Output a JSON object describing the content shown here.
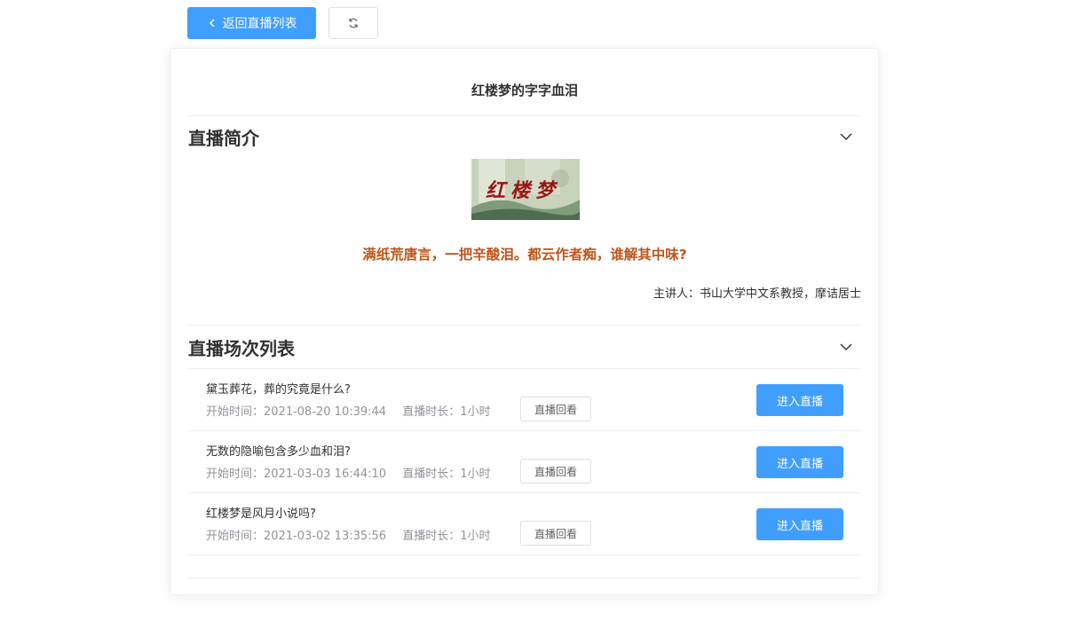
{
  "toolbar": {
    "back_label": "返回直播列表",
    "back_icon": "chevron-left-icon",
    "refresh_icon": "refresh-icon"
  },
  "course": {
    "title": "红楼梦的字字血泪",
    "intro_heading": "直播简介",
    "cover_text": "红楼梦",
    "motto": "满纸荒唐言，一把辛酸泪。都云作者痴，谁解其中味?",
    "speaker": "主讲人：书山大学中文系教授，摩诘居士"
  },
  "sessions_section": {
    "heading": "直播场次列表",
    "items": [
      {
        "title": "黛玉葬花，葬的究竟是什么?",
        "start": "开始时间：2021-08-20 10:39:44",
        "duration": "直播时长：1小时",
        "replay_label": "直播回看",
        "enter_label": "进入直播"
      },
      {
        "title": "无数的隐喻包含多少血和泪?",
        "start": "开始时间：2021-03-03 16:44:10",
        "duration": "直播时长：1小时",
        "replay_label": "直播回看",
        "enter_label": "进入直播"
      },
      {
        "title": "红楼梦是风月小说吗?",
        "start": "开始时间：2021-03-02 13:35:56",
        "duration": "直播时长：1小时",
        "replay_label": "直播回看",
        "enter_label": "进入直播"
      }
    ]
  },
  "colors": {
    "primary": "#409eff",
    "motto": "#c0541a",
    "border": "#ebeef5",
    "muted_text": "#909399"
  }
}
